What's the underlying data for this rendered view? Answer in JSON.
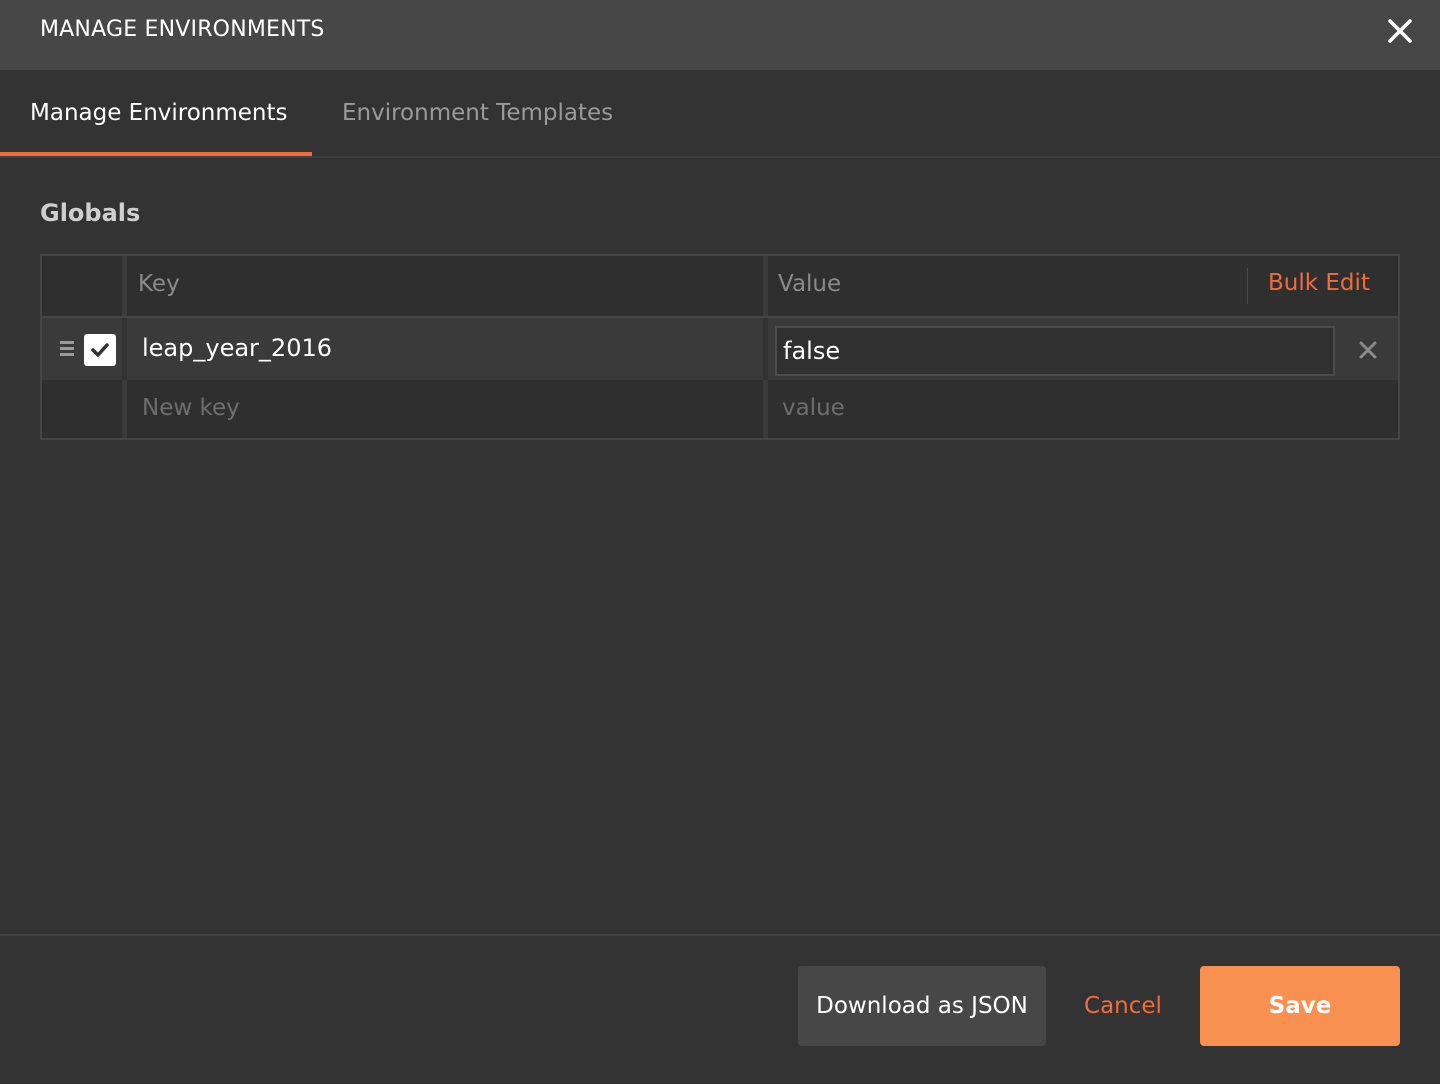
{
  "dialog": {
    "title": "MANAGE ENVIRONMENTS",
    "close_icon": "close-icon"
  },
  "tabs": [
    {
      "label": "Manage Environments",
      "active": true
    },
    {
      "label": "Environment Templates",
      "active": false
    }
  ],
  "section": {
    "title": "Globals"
  },
  "table": {
    "columns": {
      "key": "Key",
      "value": "Value"
    },
    "bulk_edit_label": "Bulk Edit",
    "rows": [
      {
        "enabled": true,
        "key": "leap_year_2016",
        "value": "false"
      }
    ],
    "new_row": {
      "key_placeholder": "New key",
      "value_placeholder": "value"
    }
  },
  "footer": {
    "download_label": "Download as JSON",
    "cancel_label": "Cancel",
    "save_label": "Save"
  },
  "colors": {
    "accent": "#f26b3a",
    "save_button": "#f89150",
    "background": "#333333",
    "titlebar": "#474747"
  }
}
